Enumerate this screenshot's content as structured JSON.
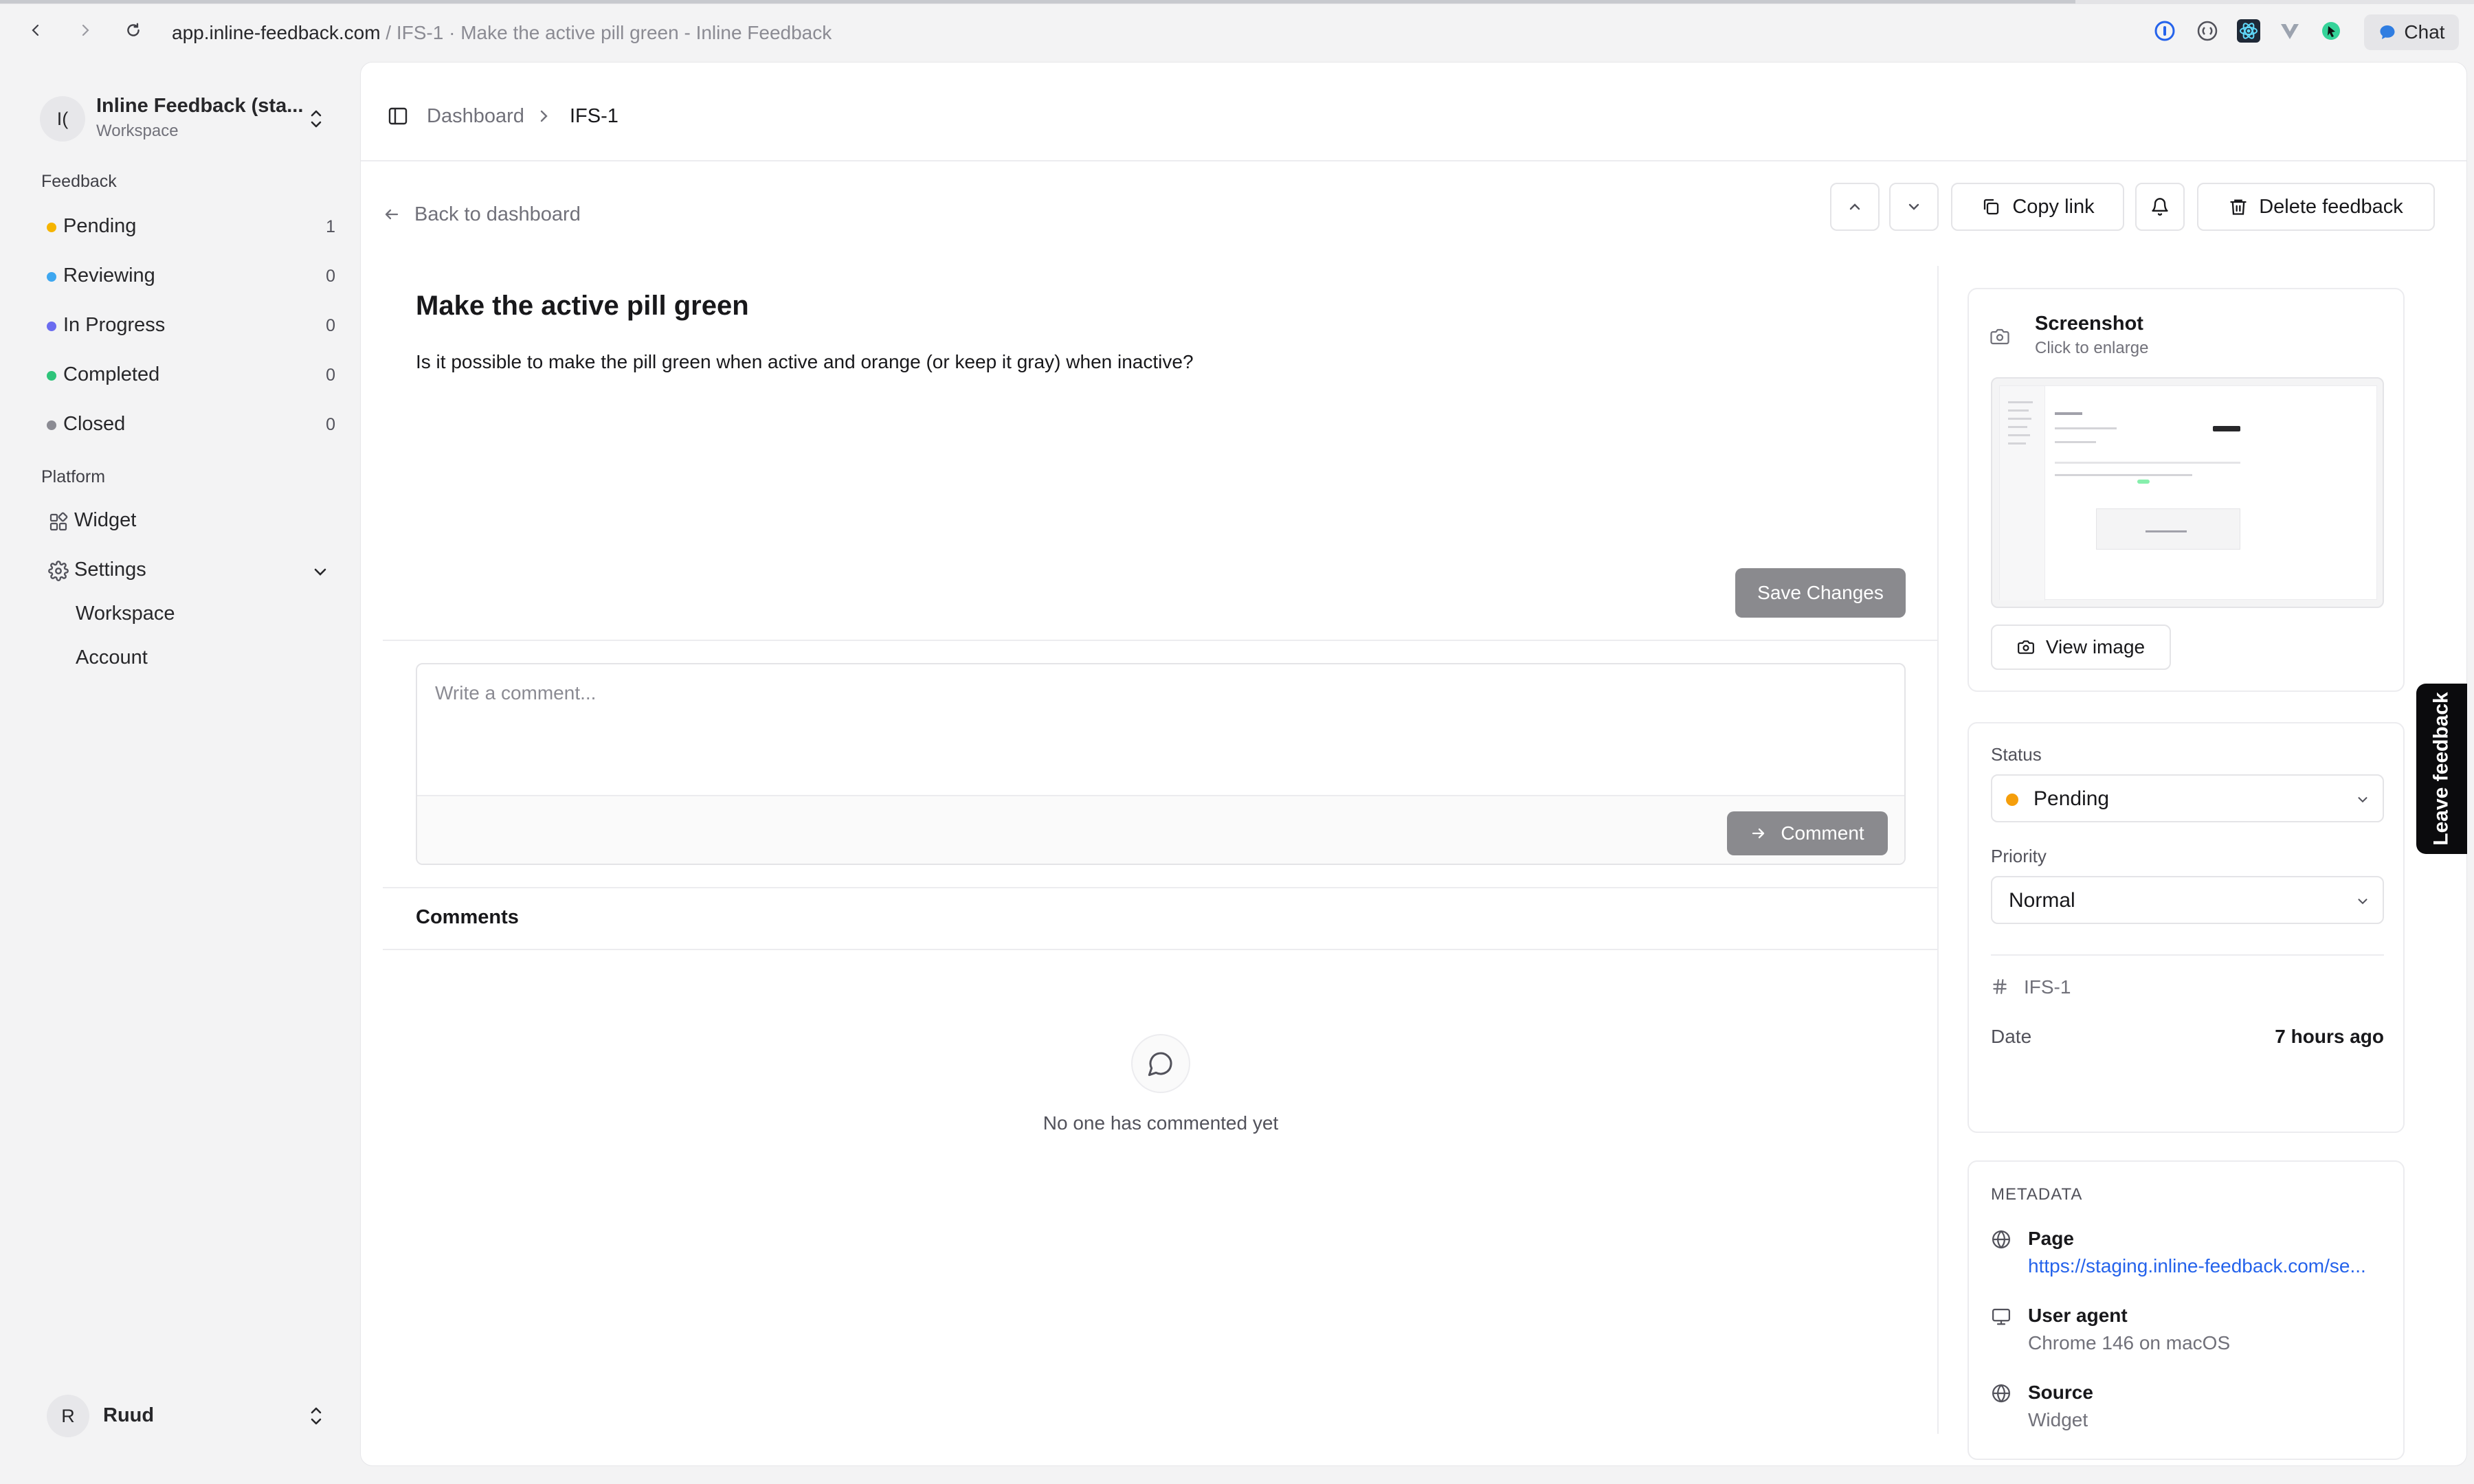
{
  "browser": {
    "url_host": "app.inline-feedback.com",
    "url_rest": " / IFS-1 · Make the active pill green - Inline Feedback",
    "chat_label": "Chat"
  },
  "sidebar": {
    "workspace_initials": "I(",
    "workspace_name": "Inline Feedback (sta...",
    "workspace_subtitle": "Workspace",
    "feedback_heading": "Feedback",
    "statuses": [
      {
        "label": "Pending",
        "count": "1",
        "color": "#f5b400"
      },
      {
        "label": "Reviewing",
        "count": "0",
        "color": "#3ea7f0"
      },
      {
        "label": "In Progress",
        "count": "0",
        "color": "#6b6cf0"
      },
      {
        "label": "Completed",
        "count": "0",
        "color": "#2ec47a"
      },
      {
        "label": "Closed",
        "count": "0",
        "color": "#8b8b93"
      }
    ],
    "platform_heading": "Platform",
    "widget_label": "Widget",
    "settings_label": "Settings",
    "settings_children": [
      "Workspace",
      "Account"
    ],
    "user_initial": "R",
    "user_name": "Ruud"
  },
  "header": {
    "breadcrumb_root": "Dashboard",
    "breadcrumb_current": "IFS-1"
  },
  "toolbar": {
    "back_label": "Back to dashboard",
    "copy_link_label": "Copy link",
    "delete_label": "Delete feedback"
  },
  "feedback": {
    "title": "Make the active pill green",
    "description": "Is it possible to make the pill green when active and orange (or keep it gray) when inactive?",
    "save_label": "Save Changes"
  },
  "comment_box": {
    "placeholder": "Write a comment...",
    "submit_label": "Comment"
  },
  "comments": {
    "heading": "Comments",
    "empty_text": "No one has commented yet"
  },
  "screenshot": {
    "title": "Screenshot",
    "subtitle": "Click to enlarge",
    "view_label": "View image"
  },
  "details": {
    "status_label": "Status",
    "status_value": "Pending",
    "status_color": "#f59e0b",
    "priority_label": "Priority",
    "priority_value": "Normal",
    "id": "IFS-1",
    "date_label": "Date",
    "date_value": "7 hours ago"
  },
  "metadata": {
    "heading": "METADATA",
    "page_label": "Page",
    "page_value": "https://staging.inline-feedback.com/se...",
    "user_agent_label": "User agent",
    "user_agent_value": "Chrome 146 on macOS",
    "source_label": "Source",
    "source_value": "Widget"
  },
  "leave_feedback_label": "Leave feedback",
  "colors": {
    "accent_link": "#2563eb",
    "disabled_button": "#8a8a8e"
  }
}
